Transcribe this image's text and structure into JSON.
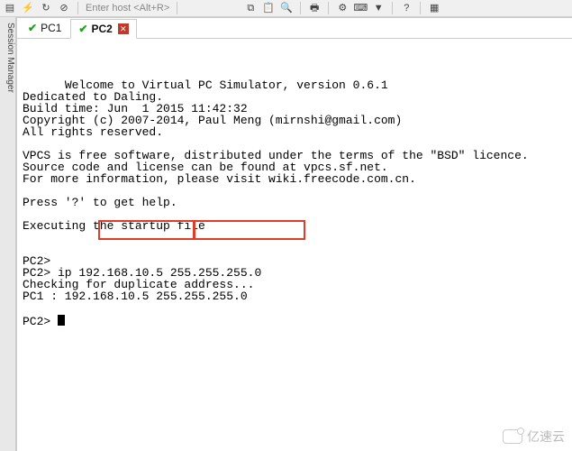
{
  "toolbar": {
    "host_placeholder": "Enter host <Alt+R>"
  },
  "sidebar": {
    "label": "Session Manager"
  },
  "tabs": [
    {
      "label": "PC1",
      "active": false
    },
    {
      "label": "PC2",
      "active": true
    }
  ],
  "terminal": {
    "lines": [
      "Welcome to Virtual PC Simulator, version 0.6.1",
      "Dedicated to Daling.",
      "Build time: Jun  1 2015 11:42:32",
      "Copyright (c) 2007-2014, Paul Meng (mirnshi@gmail.com)",
      "All rights reserved.",
      "",
      "VPCS is free software, distributed under the terms of the \"BSD\" licence.",
      "Source code and license can be found at vpcs.sf.net.",
      "For more information, please visit wiki.freecode.com.cn.",
      "",
      "Press '?' to get help.",
      "",
      "Executing the startup file",
      "",
      "",
      "PC2>",
      "PC2> ip 192.168.10.5 255.255.255.0",
      "Checking for duplicate address...",
      "PC1 : 192.168.10.5 255.255.255.0",
      "",
      "PC2> "
    ],
    "highlight_ip": "192.168.10.5",
    "highlight_mask": "255.255.255.0"
  },
  "watermark": "亿速云"
}
